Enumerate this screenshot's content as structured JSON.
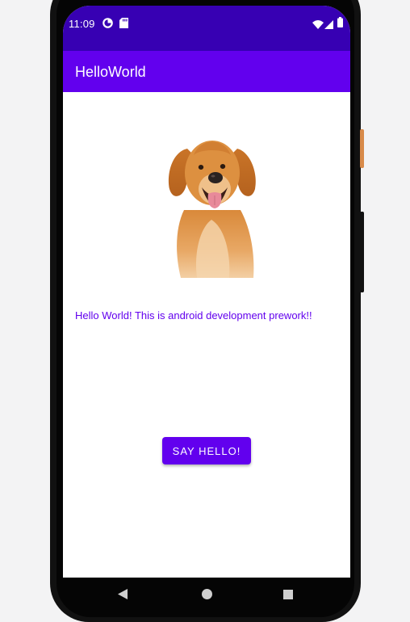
{
  "status_bar": {
    "time": "11:09",
    "background": "#3700b3",
    "left_icons": [
      "data-saver-icon",
      "sd-card-icon"
    ],
    "right_icons": [
      "wifi-icon",
      "cell-signal-icon",
      "battery-icon"
    ]
  },
  "app_bar": {
    "title": "HelloWorld",
    "background": "#6200ee"
  },
  "main": {
    "image": "golden-retriever-dog",
    "message": "Hello World! This is android development prework!!",
    "message_color": "#6200ee",
    "button_label": "SAY HELLO!"
  },
  "nav_bar": {
    "icons": [
      "back-icon",
      "home-icon",
      "recents-icon"
    ]
  }
}
